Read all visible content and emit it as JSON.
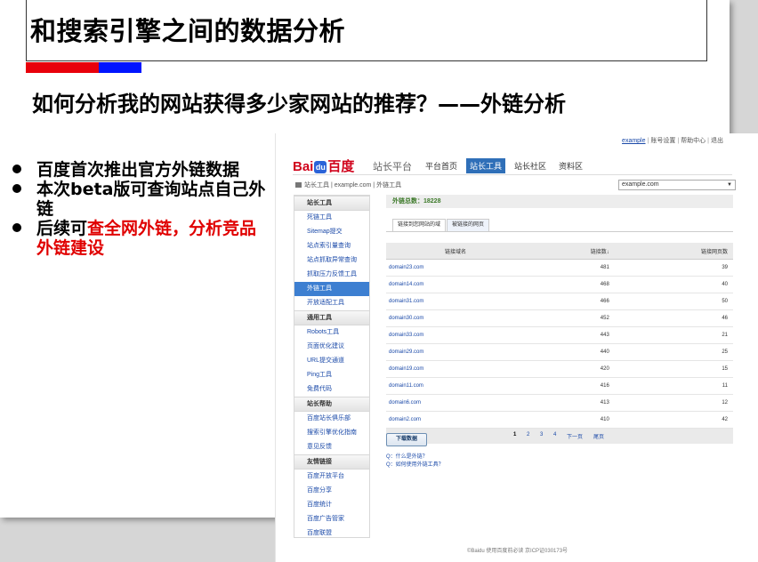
{
  "slide": {
    "title": "和搜索引擎之间的数据分析",
    "subtitle": "如何分析我的网站获得多少家网站的推荐？——外链分析",
    "bullets": [
      {
        "text": "百度首次推出官方外链数据",
        "highlight": ""
      },
      {
        "text": "本次beta版可查询站点自己外链",
        "highlight": ""
      },
      {
        "text": "后续可",
        "highlight": "查全网外链，分析竞品外链建设"
      }
    ],
    "colors": {
      "red_bar": "#e8000b",
      "blue_bar": "#0015ff",
      "highlight": "#e00000"
    }
  },
  "screenshot": {
    "top_links": [
      "example",
      "账号设置",
      "帮助中心",
      "退出"
    ],
    "logo": {
      "bai": "Bai",
      "du": "du",
      "brand": "百度"
    },
    "platform": "站长平台",
    "nav": [
      "平台首页",
      "站长工具",
      "站长社区",
      "资料区"
    ],
    "nav_active": "站长工具",
    "breadcrumb": [
      "站长工具",
      "example.com",
      "外链工具"
    ],
    "site_select": "example.com",
    "sidebar": [
      {
        "type": "head",
        "label": "站长工具"
      },
      {
        "type": "item",
        "label": "死链工具"
      },
      {
        "type": "item",
        "label": "Sitemap提交"
      },
      {
        "type": "item",
        "label": "站点索引量查询"
      },
      {
        "type": "item",
        "label": "站点抓取异常查询"
      },
      {
        "type": "item",
        "label": "抓取压力反馈工具"
      },
      {
        "type": "item",
        "label": "外链工具",
        "active": true
      },
      {
        "type": "item",
        "label": "开放适配工具"
      },
      {
        "type": "head",
        "label": "通用工具"
      },
      {
        "type": "item",
        "label": "Robots工具"
      },
      {
        "type": "item",
        "label": "页面优化建议"
      },
      {
        "type": "item",
        "label": "URL提交通道"
      },
      {
        "type": "item",
        "label": "Ping工具"
      },
      {
        "type": "item",
        "label": "免费代码"
      },
      {
        "type": "head",
        "label": "站长帮助"
      },
      {
        "type": "item",
        "label": "百度站长俱乐部"
      },
      {
        "type": "item",
        "label": "搜索引擎优化指南"
      },
      {
        "type": "item",
        "label": "意见反馈"
      },
      {
        "type": "head",
        "label": "友情链接"
      },
      {
        "type": "item",
        "label": "百度开放平台"
      },
      {
        "type": "item",
        "label": "百度分享"
      },
      {
        "type": "item",
        "label": "百度统计"
      },
      {
        "type": "item",
        "label": "百度广告管家"
      },
      {
        "type": "item",
        "label": "百度联盟"
      }
    ],
    "total_label": "外链总数：18228",
    "tabs": [
      "链接到您网站的域",
      "被链接的网页"
    ],
    "table": {
      "headers": [
        "链接域名",
        "链接数↓",
        "链接网页数"
      ],
      "rows": [
        [
          "domain23.com",
          "481",
          "39"
        ],
        [
          "domain14.com",
          "468",
          "40"
        ],
        [
          "domain31.com",
          "466",
          "50"
        ],
        [
          "domain30.com",
          "452",
          "46"
        ],
        [
          "domain33.com",
          "443",
          "21"
        ],
        [
          "domain29.com",
          "440",
          "25"
        ],
        [
          "domain19.com",
          "420",
          "15"
        ],
        [
          "domain11.com",
          "416",
          "11"
        ],
        [
          "domain6.com",
          "413",
          "12"
        ],
        [
          "domain2.com",
          "410",
          "42"
        ]
      ]
    },
    "pager": [
      "1",
      "2",
      "3",
      "4",
      "下一页",
      "尾页"
    ],
    "download_button": "下载数据",
    "faq": [
      "Q：什么是外链？",
      "Q：如何使用外链工具？"
    ],
    "footer": "©Baidu 使用百度前必读 京ICP证030173号"
  }
}
